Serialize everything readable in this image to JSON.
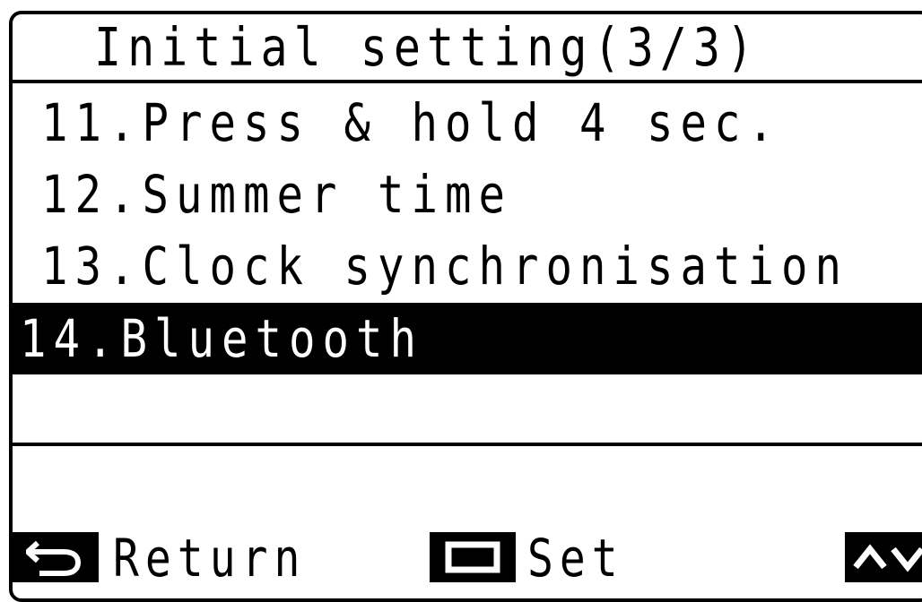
{
  "screen": {
    "title": "Initial setting(3/3)"
  },
  "menu": {
    "items": [
      {
        "label": "11.Press & hold 4 sec."
      },
      {
        "label": "12.Summer time"
      },
      {
        "label": "13.Clock synchronisation"
      },
      {
        "label": "14.Bluetooth",
        "selected": true
      }
    ]
  },
  "footer": {
    "return_label": "Return",
    "set_label": "Set",
    "return_icon": "return-arrow-icon",
    "set_icon": "rectangle-button-icon",
    "updown_icon": "up-down-arrows-icon"
  },
  "colors": {
    "foreground": "#000000",
    "background": "#ffffff"
  }
}
